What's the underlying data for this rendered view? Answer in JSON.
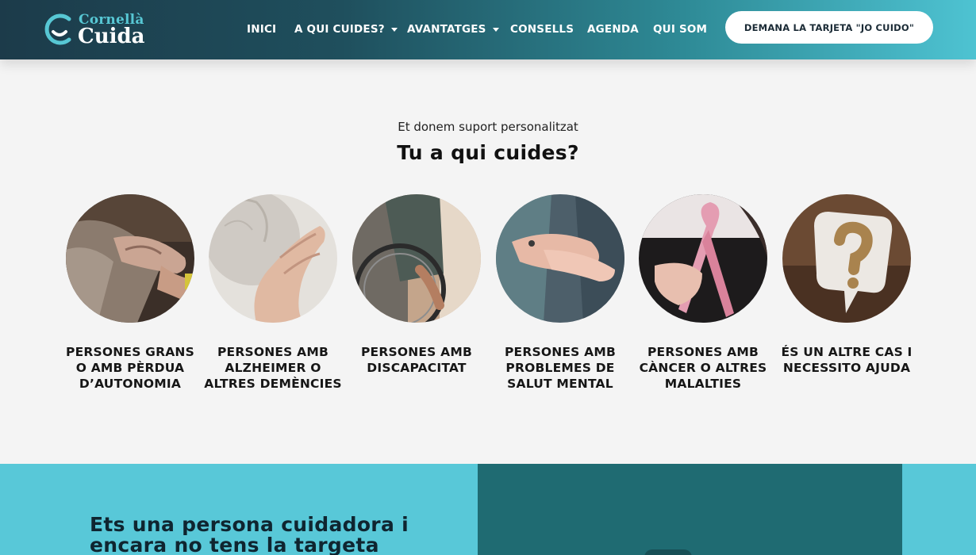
{
  "header": {
    "logo": {
      "top": "Cornellà",
      "bottom": "Cuida"
    },
    "nav": [
      {
        "label": "INICI",
        "dropdown": false
      },
      {
        "label": "A QUI CUIDES?",
        "dropdown": true
      },
      {
        "label": "AVANTATGES",
        "dropdown": true
      },
      {
        "label": "CONSELLS",
        "dropdown": false
      },
      {
        "label": "AGENDA",
        "dropdown": false
      },
      {
        "label": "QUI SOM",
        "dropdown": false
      }
    ],
    "cta_label": "DEMANA LA TARJETA \"JO CUIDO\""
  },
  "intro": {
    "subtitle": "Et donem suport personalitzat",
    "title": "Tu a qui cuides?"
  },
  "cards": [
    {
      "label": "PERSONES GRANS O AMB PÈRDUA D’AUTONOMIA",
      "image": "elderly-hands-photo"
    },
    {
      "label": "PERSONES AMB ALZHEIMER O ALTRES DEMÈNCIES",
      "image": "dementia-hand-photo"
    },
    {
      "label": "PERSONES AMB DISCAPACITAT",
      "image": "wheelchair-photo"
    },
    {
      "label": "PERSONES AMB PROBLEMES DE SALUT MENTAL",
      "image": "holding-hands-photo"
    },
    {
      "label": "PERSONES AMB CÀNCER O ALTRES MALALTIES",
      "image": "pink-ribbon-photo"
    },
    {
      "label": "ÉS UN ALTRE CAS I NECESSITO AJUDA",
      "image": "question-mark-photo"
    }
  ],
  "bottom": {
    "heading": "Ets una persona cuidadora i encara no tens la targeta"
  },
  "colors": {
    "header_start": "#1c3b4a",
    "header_end": "#4ec3d2",
    "accent_teal": "#58c8d8",
    "dark_teal": "#1f6b72",
    "background": "#f4f4f4"
  }
}
